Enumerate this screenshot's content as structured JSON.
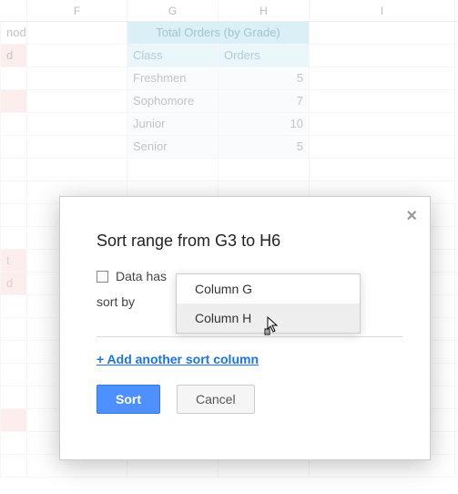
{
  "columns": {
    "E": "",
    "F": "F",
    "G": "G",
    "H": "H",
    "I": "I"
  },
  "sheet": {
    "title": "Total Orders (by Grade)",
    "headers": {
      "class": "Class",
      "orders": "Orders"
    },
    "rows": [
      {
        "class": "Freshmen",
        "orders": "5"
      },
      {
        "class": "Sophomore",
        "orders": "7"
      },
      {
        "class": "Junior",
        "orders": "10"
      },
      {
        "class": "Senior",
        "orders": "5"
      }
    ],
    "left_fragments": {
      "r1": "nod",
      "r2": "d",
      "r11": "t",
      "r12": "d"
    }
  },
  "modal": {
    "title": "Sort range from G3 to H6",
    "checkbox_label": "Data has",
    "sort_by_label": "sort by",
    "add_link": "+ Add another sort column",
    "sort_btn": "Sort",
    "cancel_btn": "Cancel"
  },
  "dropdown": {
    "options": [
      "Column G",
      "Column H"
    ]
  }
}
